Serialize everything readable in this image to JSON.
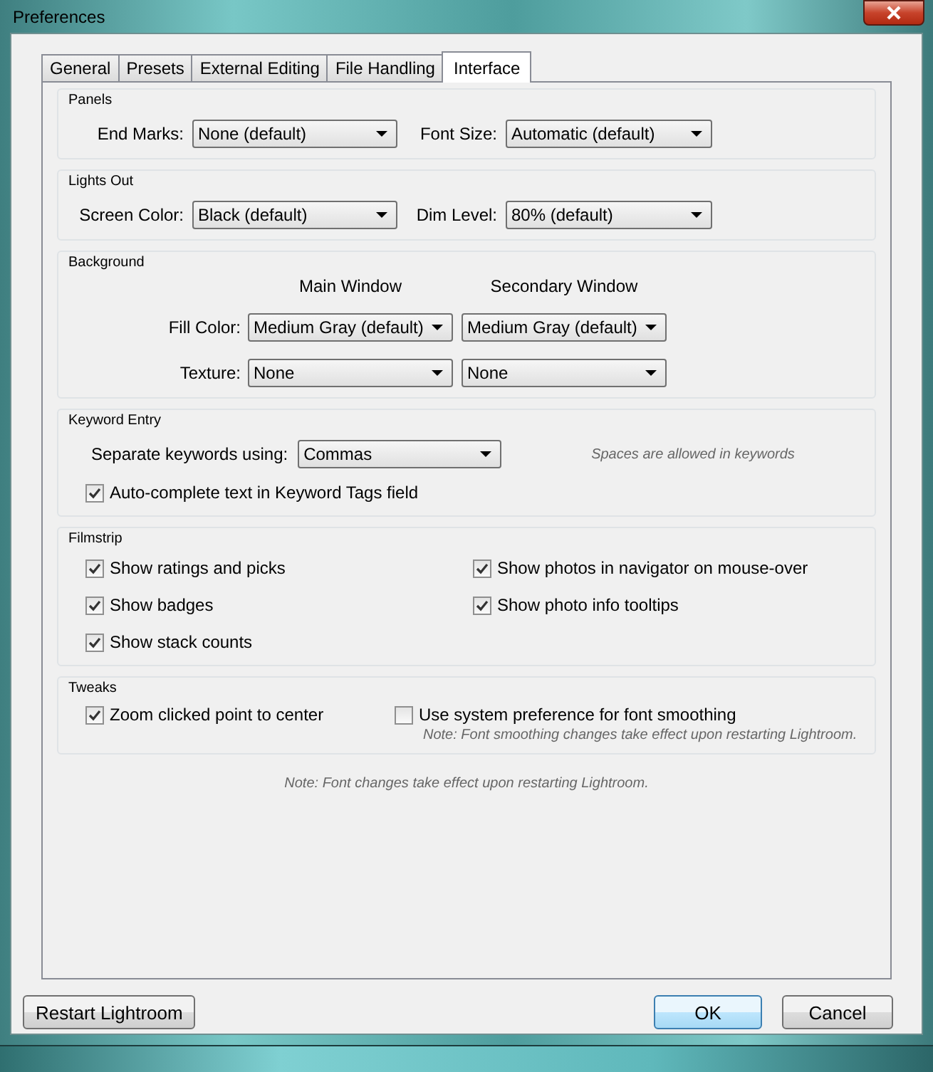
{
  "window": {
    "title": "Preferences"
  },
  "tabs": [
    {
      "label": "General",
      "selected": false
    },
    {
      "label": "Presets",
      "selected": false
    },
    {
      "label": "External Editing",
      "selected": false
    },
    {
      "label": "File Handling",
      "selected": false
    },
    {
      "label": "Interface",
      "selected": true
    }
  ],
  "panels": {
    "title": "Panels",
    "fields": [
      {
        "label": "End Marks:",
        "value": "None (default)"
      },
      {
        "label": "Font Size:",
        "value": "Automatic (default)"
      }
    ]
  },
  "lights_out": {
    "title": "Lights Out",
    "fields": [
      {
        "label": "Screen Color:",
        "value": "Black (default)"
      },
      {
        "label": "Dim Level:",
        "value": "80% (default)"
      }
    ]
  },
  "background": {
    "title": "Background",
    "columns": [
      "Main Window",
      "Secondary Window"
    ],
    "rows": [
      {
        "label": "Fill Color:",
        "values": [
          "Medium Gray (default)",
          "Medium Gray (default)"
        ]
      },
      {
        "label": "Texture:",
        "values": [
          "None",
          "None"
        ]
      }
    ]
  },
  "keyword_entry": {
    "title": "Keyword Entry",
    "field": {
      "label": "Separate keywords using:",
      "value": "Commas"
    },
    "hint": "Spaces are allowed in keywords",
    "checkboxes": [
      {
        "label": "Auto-complete text in Keyword Tags field",
        "checked": true
      }
    ]
  },
  "filmstrip": {
    "title": "Filmstrip",
    "columns": [
      [
        {
          "label": "Show ratings and picks",
          "checked": true
        },
        {
          "label": "Show badges",
          "checked": true
        },
        {
          "label": "Show stack counts",
          "checked": true
        }
      ],
      [
        {
          "label": "Show photos in navigator on mouse-over",
          "checked": true
        },
        {
          "label": "Show photo info tooltips",
          "checked": true
        }
      ]
    ]
  },
  "tweaks": {
    "title": "Tweaks",
    "options": [
      {
        "label": "Zoom clicked point to center",
        "checked": true
      },
      {
        "label": "Use system preference for font smoothing",
        "checked": false,
        "note": "Note: Font smoothing changes take effect upon restarting Lightroom."
      }
    ]
  },
  "footer_note": "Note: Font changes take effect upon restarting Lightroom.",
  "left_buttons": [
    {
      "label": "Restart Lightroom",
      "default": false
    }
  ],
  "right_buttons": [
    {
      "label": "OK",
      "default": true
    },
    {
      "label": "Cancel",
      "default": false
    }
  ]
}
